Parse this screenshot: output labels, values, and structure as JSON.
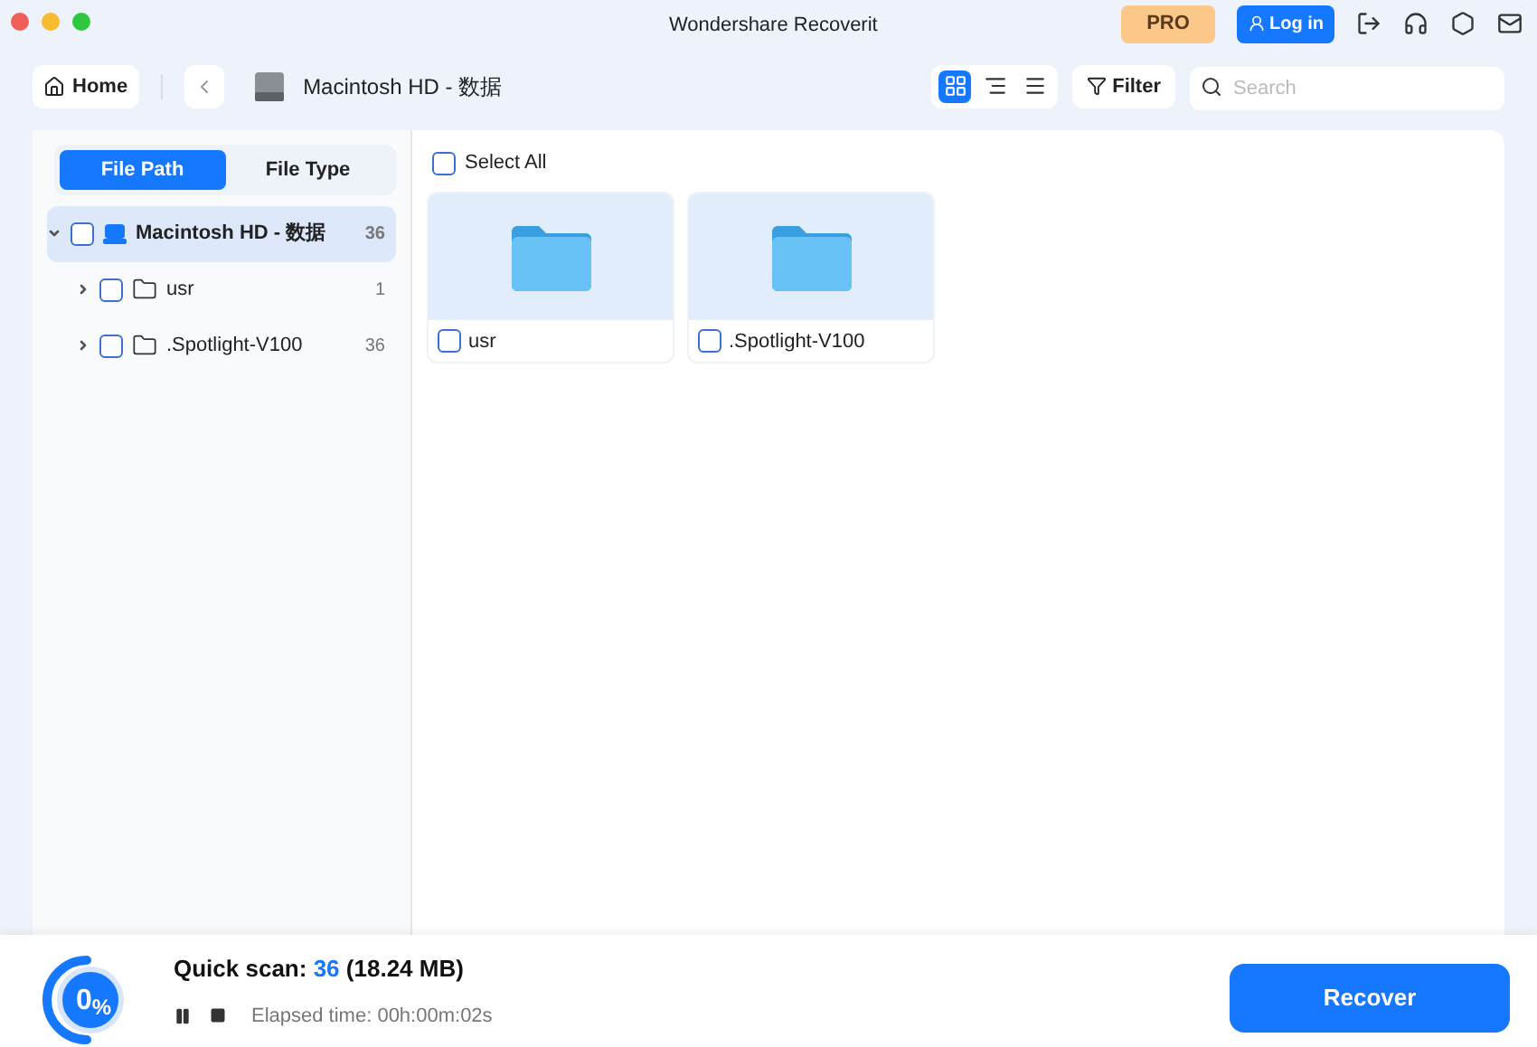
{
  "window": {
    "title": "Wondershare Recoverit"
  },
  "header": {
    "pro": "PRO",
    "login": "Log in"
  },
  "toolbar": {
    "home": "Home",
    "location": "Macintosh HD - 数据",
    "views": [
      {
        "kind": "grid",
        "selected": true
      },
      {
        "kind": "columns",
        "selected": false
      },
      {
        "kind": "list",
        "selected": false
      }
    ],
    "filter": "Filter",
    "search": {
      "placeholder": "Search"
    }
  },
  "sidebar": {
    "tabs": [
      {
        "label": "File Path",
        "selected": true
      },
      {
        "label": "File Type",
        "selected": false
      }
    ],
    "tree": [
      {
        "kind": "drive",
        "label": "Macintosh HD - 数据",
        "count": "36",
        "checked": false,
        "expanded": true,
        "selected": true,
        "children": [
          {
            "kind": "folder",
            "label": "usr",
            "count": "1",
            "checked": false,
            "expanded": false,
            "selected": false
          },
          {
            "kind": "folder",
            "label": ".Spotlight-V100",
            "count": "36",
            "checked": false,
            "expanded": false,
            "selected": false
          }
        ]
      }
    ]
  },
  "content": {
    "select_all": {
      "label": "Select All",
      "checked": false
    },
    "items": [
      {
        "name": "usr",
        "checked": false
      },
      {
        "name": ".Spotlight-V100",
        "checked": false
      }
    ]
  },
  "status": {
    "progress": "0$_{%}$",
    "scan_label": "Quick scan:",
    "scan_count": "36",
    "scan_size": "(18.24 MB)",
    "elapsed": "Elapsed time: 00h:00m:02s",
    "recover": "Recover"
  }
}
